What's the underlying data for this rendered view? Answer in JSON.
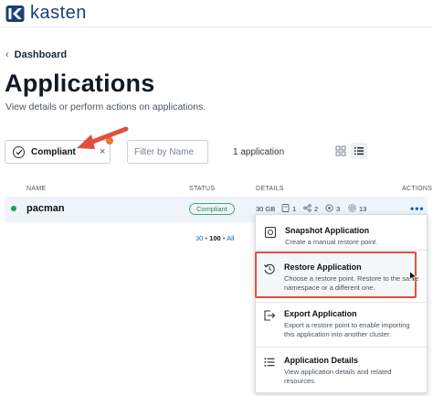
{
  "header": {
    "brand": "kasten",
    "logo_icon": "kasten-logo-icon"
  },
  "breadcrumb": {
    "label": "Dashboard",
    "icon": "chevron-left-icon"
  },
  "page": {
    "title": "Applications",
    "subtitle": "View details or perform actions on applications."
  },
  "filters": {
    "chip_label": "Compliant",
    "chip_close": "×",
    "search_placeholder": "Filter by Name",
    "count_text": "1 application"
  },
  "table": {
    "headers": {
      "name": "NAME",
      "status": "STATUS",
      "details": "DETAILS",
      "actions": "ACTIONS"
    },
    "rows": [
      {
        "name": "pacman",
        "status": "Compliant",
        "size": "30 GB",
        "volumes": "1",
        "networks": "2",
        "workloads": "3",
        "resources": "13",
        "actions": "•••"
      }
    ]
  },
  "pagination": {
    "prev": "30",
    "sep1": "•",
    "current": "100",
    "sep2": "•",
    "all": "All"
  },
  "menu": {
    "items": [
      {
        "title": "Snapshot Application",
        "desc": "Create a manual restore point.",
        "icon": "snapshot-icon"
      },
      {
        "title": "Restore Application",
        "desc": "Choose a restore point. Restore to the same namespace or a different one.",
        "icon": "restore-icon"
      },
      {
        "title": "Export Application",
        "desc": "Export a restore point to enable importing this application into another cluster.",
        "icon": "export-icon"
      },
      {
        "title": "Application Details",
        "desc": "View application details and related resources.",
        "icon": "details-list-icon"
      }
    ]
  },
  "colors": {
    "accent": "#1565c0",
    "brand": "#1c3f7a",
    "highlight": "#e0503f",
    "status_ok": "#1a9d58",
    "badge_dot": "#e8782a"
  }
}
